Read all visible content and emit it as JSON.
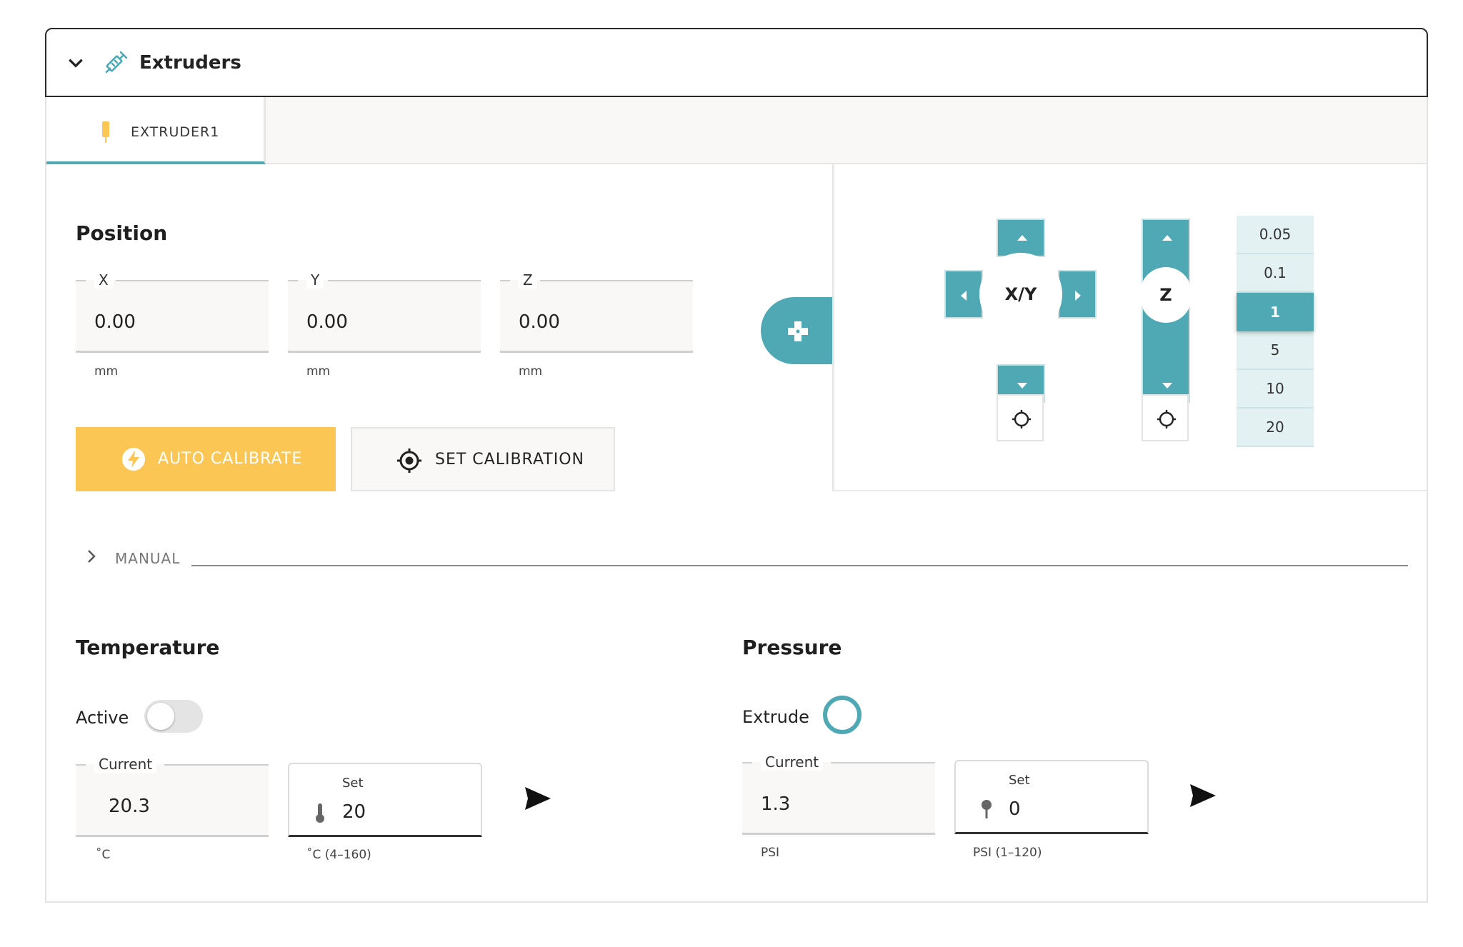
{
  "header": {
    "title": "Extruders",
    "collapse_icon": "chevron-down-icon",
    "app_icon": "syringe-icon"
  },
  "tabs": [
    {
      "label": "EXTRUDER1",
      "icon": "pin-icon",
      "active": true
    }
  ],
  "position": {
    "heading": "Position",
    "fields": [
      {
        "label": "X",
        "value": "0.00",
        "unit": "mm"
      },
      {
        "label": "Y",
        "value": "0.00",
        "unit": "mm"
      },
      {
        "label": "Z",
        "value": "0.00",
        "unit": "mm"
      }
    ],
    "auto_calibrate_label": "AUTO CALIBRATE",
    "set_calibration_label": "SET CALIBRATION"
  },
  "jog": {
    "xy_label": "X/Y",
    "z_label": "Z",
    "steps": [
      "0.05",
      "0.1",
      "1",
      "5",
      "10",
      "20"
    ],
    "selected_step": "1"
  },
  "manual": {
    "label": "MANUAL"
  },
  "temperature": {
    "heading": "Temperature",
    "active_label": "Active",
    "active": false,
    "current_label": "Current",
    "current_value": "20.3",
    "current_unit": "˚C",
    "set_label": "Set",
    "set_value": "20",
    "set_unit": "˚C (4–160)"
  },
  "pressure": {
    "heading": "Pressure",
    "extrude_label": "Extrude",
    "current_label": "Current",
    "current_value": "1.3",
    "current_unit": "PSI",
    "set_label": "Set",
    "set_value": "0",
    "set_unit": "PSI (1–120)"
  },
  "colors": {
    "accent": "#4fa9b4",
    "auto_calibrate": "#fcc655"
  }
}
